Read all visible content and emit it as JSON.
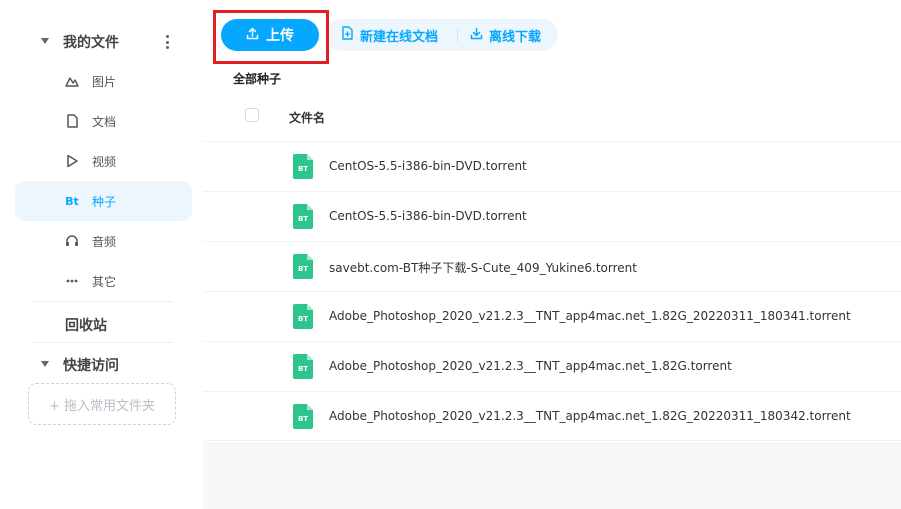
{
  "sidebar": {
    "my_files_label": "我的文件",
    "items": [
      {
        "label": "图片",
        "icon": "mountain-icon"
      },
      {
        "label": "文档",
        "icon": "document-icon"
      },
      {
        "label": "视频",
        "icon": "play-icon"
      },
      {
        "label": "种子",
        "icon": "bt-icon",
        "icon_text": "Bt",
        "active": true
      },
      {
        "label": "音频",
        "icon": "headphones-icon"
      },
      {
        "label": "其它",
        "icon": "more-icon"
      }
    ],
    "recycle_label": "回收站",
    "quick_access_label": "快捷访问",
    "drop_fav_label": "+ 拖入常用文件夹"
  },
  "toolbar": {
    "upload_label": "上传",
    "new_doc_label": "新建在线文档",
    "offline_download_label": "离线下载"
  },
  "breadcrumb": "全部种子",
  "table": {
    "header_name": "文件名",
    "file_icon_text": "BT",
    "rows": [
      {
        "name": "CentOS-5.5-i386-bin-DVD.torrent"
      },
      {
        "name": "CentOS-5.5-i386-bin-DVD.torrent"
      },
      {
        "name": "savebt.com-BT种子下载-S-Cute_409_Yukine6.torrent"
      },
      {
        "name": "Adobe_Photoshop_2020_v21.2.3__TNT_app4mac.net_1.82G_20220311_180341.torrent"
      },
      {
        "name": "Adobe_Photoshop_2020_v21.2.3__TNT_app4mac.net_1.82G.torrent"
      },
      {
        "name": "Adobe_Photoshop_2020_v21.2.3__TNT_app4mac.net_1.82G_20220311_180342.torrent"
      }
    ]
  },
  "colors": {
    "accent": "#06a7ff",
    "file_icon": "#2dc58c",
    "highlight": "#e02020"
  }
}
